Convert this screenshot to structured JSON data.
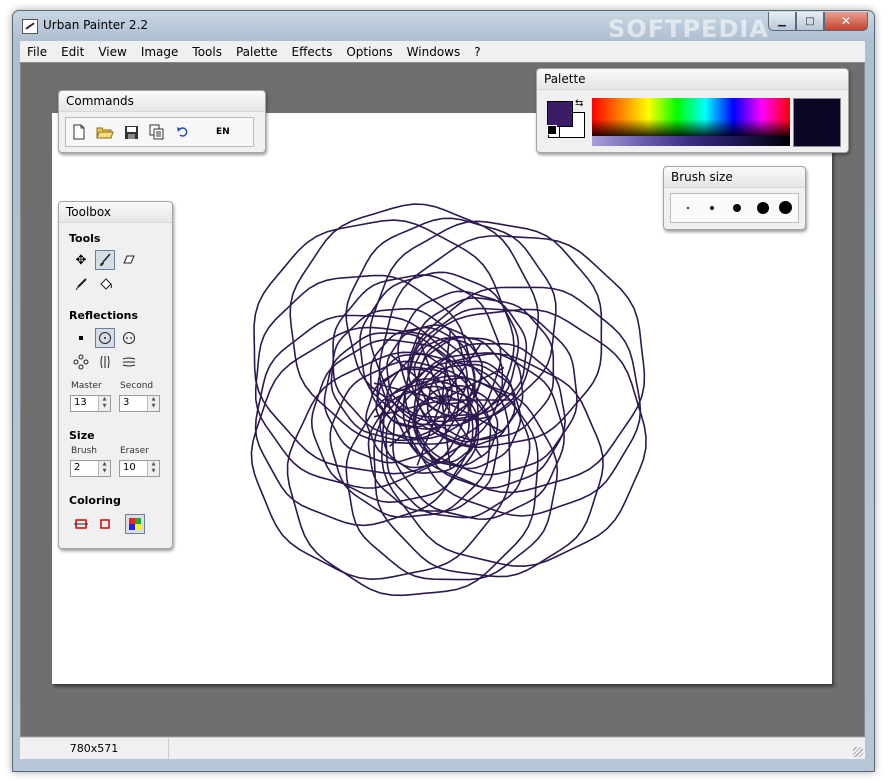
{
  "window": {
    "title": "Urban Painter 2.2",
    "watermark": "SOFTPEDIA"
  },
  "menu": [
    "File",
    "Edit",
    "View",
    "Image",
    "Tools",
    "Palette",
    "Effects",
    "Options",
    "Windows",
    "?"
  ],
  "commands": {
    "title": "Commands",
    "language": "EN",
    "icons": [
      "new-document-icon",
      "open-folder-icon",
      "save-icon",
      "copy-icon",
      "undo-icon"
    ]
  },
  "toolbox": {
    "title": "Toolbox",
    "tools_header": "Tools",
    "tools": [
      "move-icon",
      "brush-icon",
      "eraser-icon",
      "eyedropper-icon",
      "bucket-fill-icon"
    ],
    "reflections_header": "Reflections",
    "reflections": [
      "reflection-none-icon",
      "reflection-radial-icon",
      "reflection-radial-dual-icon",
      "reflection-flower-icon",
      "reflection-vertical-icon",
      "reflection-horizontal-icon"
    ],
    "master_label": "Master",
    "master_value": "13",
    "second_label": "Second",
    "second_value": "3",
    "size_header": "Size",
    "brush_label": "Brush",
    "brush_value": "2",
    "eraser_label": "Eraser",
    "eraser_value": "10",
    "coloring_header": "Coloring",
    "coloring": [
      "color-solid-icon",
      "color-outline-icon",
      "color-multi-icon"
    ]
  },
  "palette": {
    "title": "Palette",
    "foreground": "#3a1d68",
    "preview": "#0a0724",
    "watermark": "SOFTPEDIA"
  },
  "brush_size": {
    "title": "Brush size",
    "options_count": 5
  },
  "status": {
    "canvas_size": "780x571"
  },
  "canvas": {
    "stroke_color": "#2d1850"
  }
}
